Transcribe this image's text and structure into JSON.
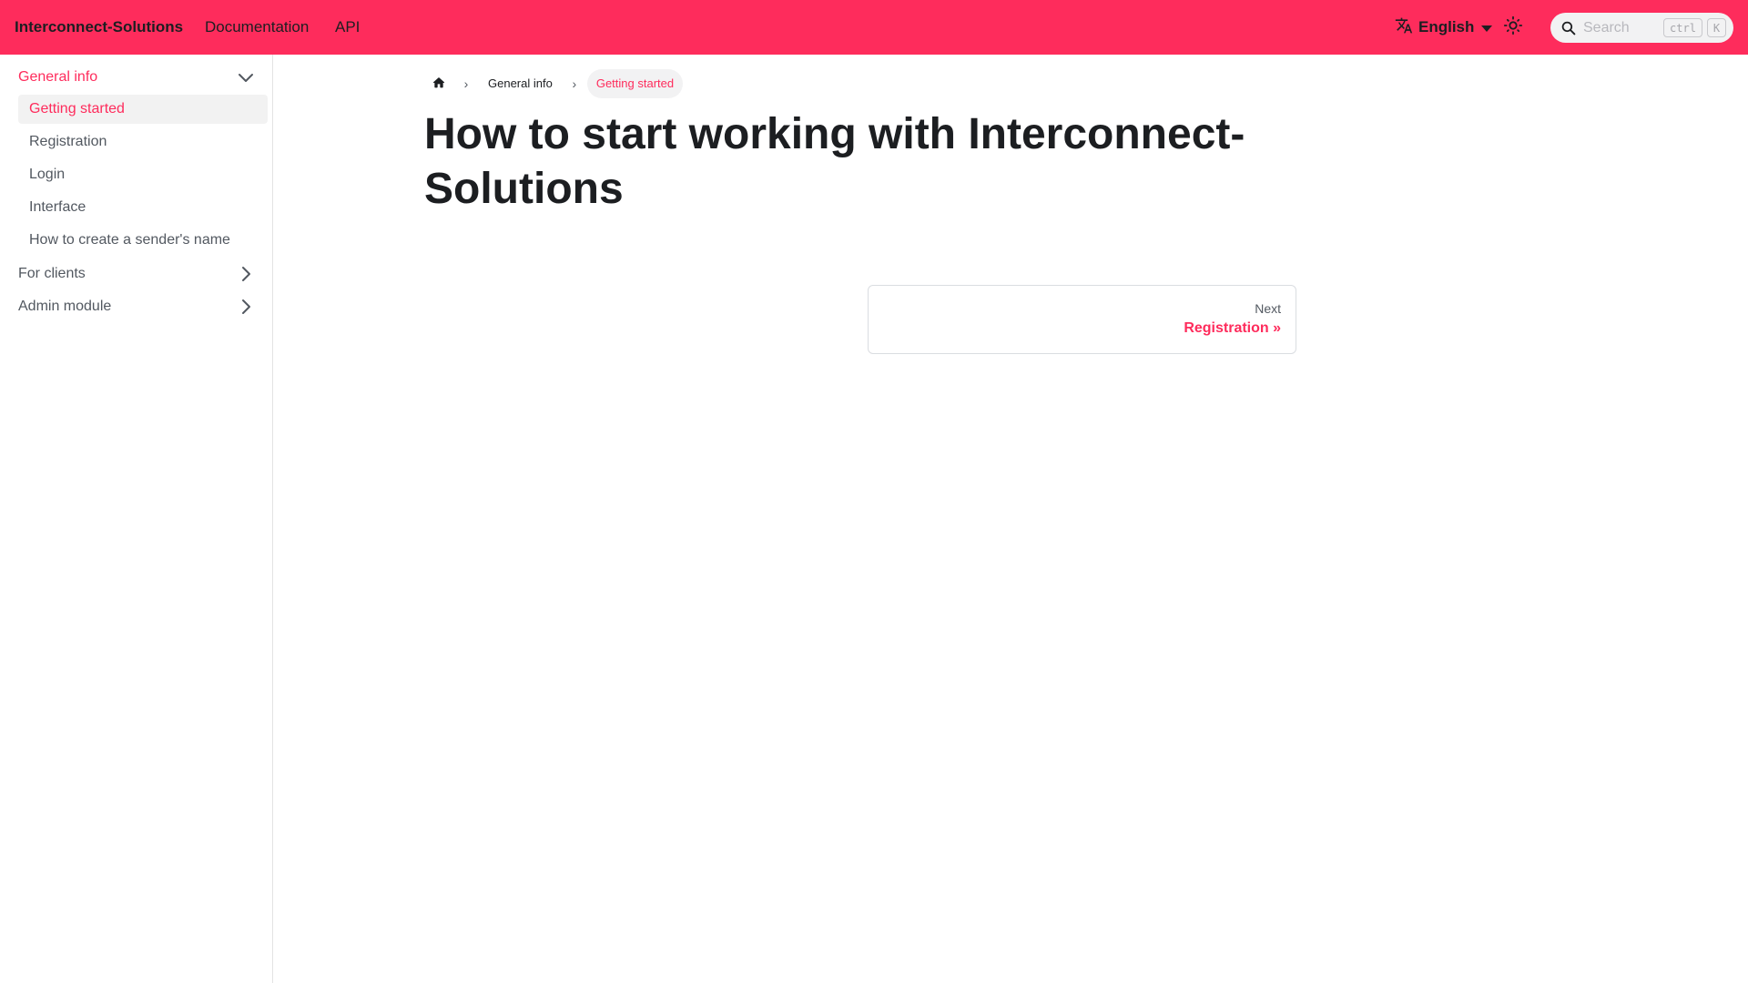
{
  "navbar": {
    "brand": "Interconnect-Solutions",
    "links": [
      "Documentation",
      "API"
    ],
    "language": "English",
    "search_placeholder": "Search",
    "shortcut_keys": [
      "ctrl",
      "K"
    ],
    "accent_color": "#fe2c5c"
  },
  "sidebar": {
    "categories": [
      {
        "label": "General info",
        "expanded": true,
        "items": [
          "Getting started",
          "Registration",
          "Login",
          "Interface",
          "How to create a sender's name"
        ]
      },
      {
        "label": "For clients",
        "expanded": false
      },
      {
        "label": "Admin module",
        "expanded": false
      }
    ],
    "active_item": "Getting started"
  },
  "breadcrumbs": {
    "items": [
      "General info",
      "Getting started"
    ]
  },
  "page": {
    "title": "How to start working with Interconnect-Solutions"
  },
  "pagination": {
    "next_sublabel": "Next",
    "next_label": "Registration »"
  },
  "icons": {
    "language": "translate-icon",
    "theme": "sun-icon",
    "search": "search-icon",
    "home": "home-icon"
  }
}
